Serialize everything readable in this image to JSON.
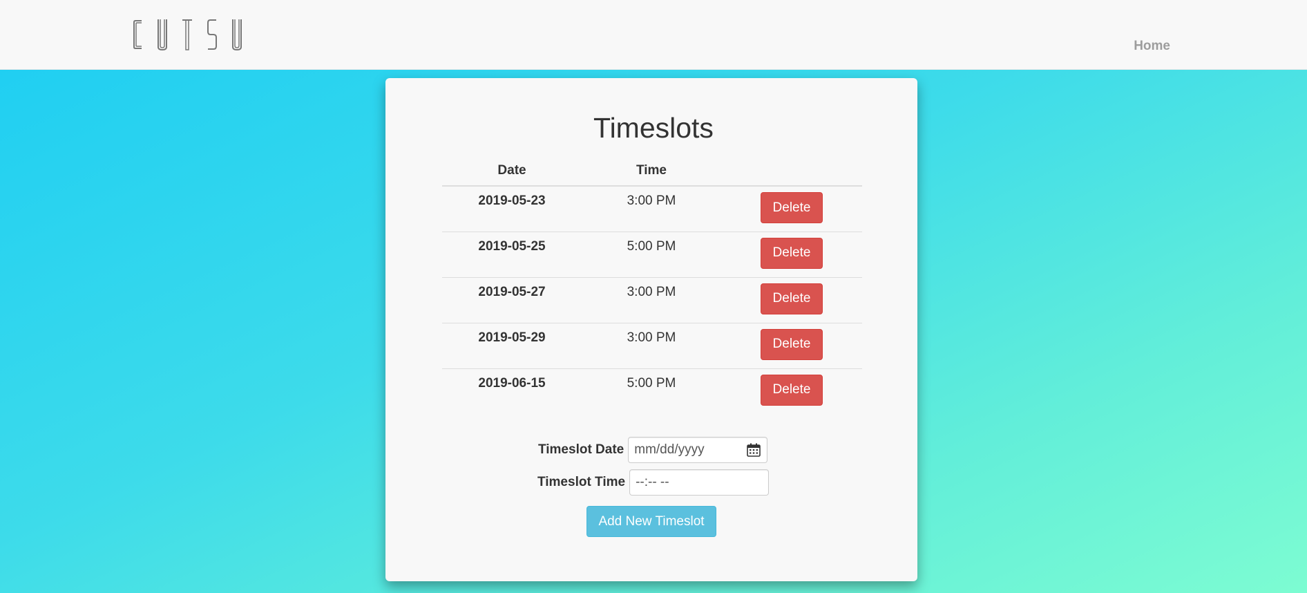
{
  "navbar": {
    "brand_letters": [
      "C",
      "U",
      "T",
      "S",
      "U"
    ],
    "home_label": "Home"
  },
  "card": {
    "title": "Timeslots"
  },
  "table": {
    "headers": {
      "date": "Date",
      "time": "Time",
      "action": ""
    },
    "rows": [
      {
        "date": "2019-05-23",
        "time": "3:00 PM",
        "action": "Delete"
      },
      {
        "date": "2019-05-25",
        "time": "5:00 PM",
        "action": "Delete"
      },
      {
        "date": "2019-05-27",
        "time": "3:00 PM",
        "action": "Delete"
      },
      {
        "date": "2019-05-29",
        "time": "3:00 PM",
        "action": "Delete"
      },
      {
        "date": "2019-06-15",
        "time": "5:00 PM",
        "action": "Delete"
      }
    ]
  },
  "form": {
    "date_label": "Timeslot Date",
    "date_placeholder": "mm/dd/yyyy",
    "time_label": "Timeslot Time",
    "time_placeholder": "--:-- --",
    "submit_label": "Add New Timeslot"
  },
  "colors": {
    "delete": "#d9534f",
    "info": "#5bc0de",
    "nav_text": "#9d9d9d"
  },
  "icons": {
    "date_field": "calendar-icon"
  }
}
